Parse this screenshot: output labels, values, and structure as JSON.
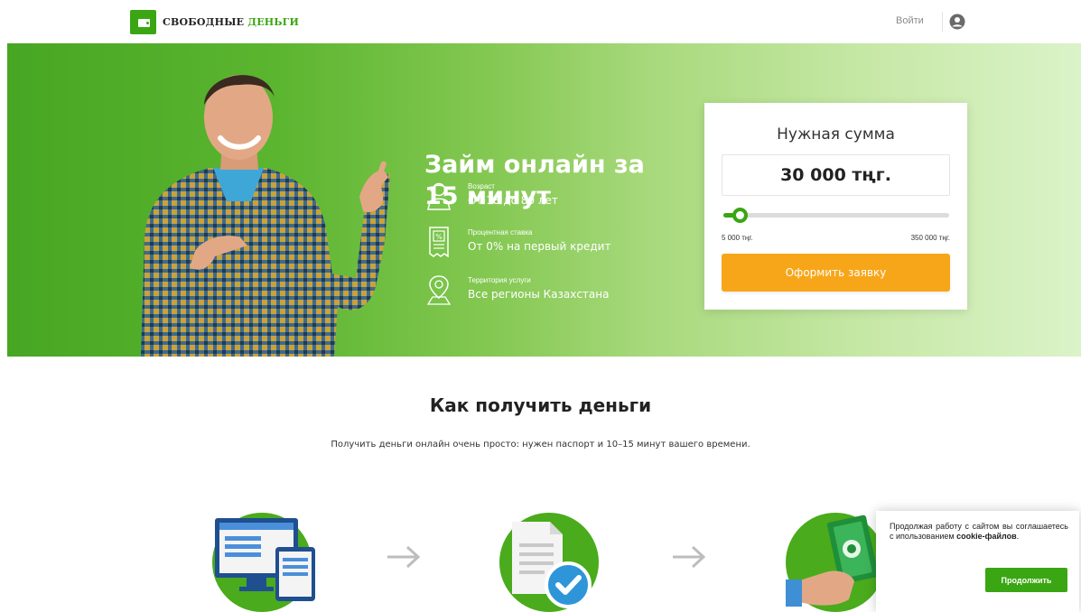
{
  "header": {
    "logo_main": "СВОБОДНЫЕ",
    "logo_accent": "ДЕНЬГИ",
    "login_label": "Войти"
  },
  "hero": {
    "title_line1": "Займ онлайн за",
    "title_line2": "15 минут",
    "features": [
      {
        "label": "Возраст",
        "value": "От 18 до 80 лет",
        "icon": "person-icon"
      },
      {
        "label": "Процентная ставка",
        "value": "От 0% на первый кредит",
        "icon": "percent-receipt-icon"
      },
      {
        "label": "Территория услуги",
        "value": "Все регионы Казахстана",
        "icon": "map-pin-icon"
      }
    ]
  },
  "calculator": {
    "title": "Нужная сумма",
    "amount": "30 000 тңг.",
    "min_label": "5 000 тңг.",
    "max_label": "350 000 тңг.",
    "slider_fraction": 0.073,
    "button_label": "Оформить заявку"
  },
  "how": {
    "title": "Как получить деньги",
    "subtitle": "Получить деньги онлайн очень просто: нужен паспорт и 10–15 минут вашего времени.",
    "steps": [
      {
        "icon": "computer-form-icon"
      },
      {
        "icon": "document-check-icon"
      },
      {
        "icon": "money-hand-icon"
      }
    ]
  },
  "cookie": {
    "text": "Продолжая работу с сайтом вы соглашаетесь с ипользованием ",
    "text_bold": "cookie-файлов",
    "text_end": ".",
    "button_label": "Продолжить"
  },
  "colors": {
    "brand_green": "#3aa613",
    "button_orange": "#f8a619"
  }
}
